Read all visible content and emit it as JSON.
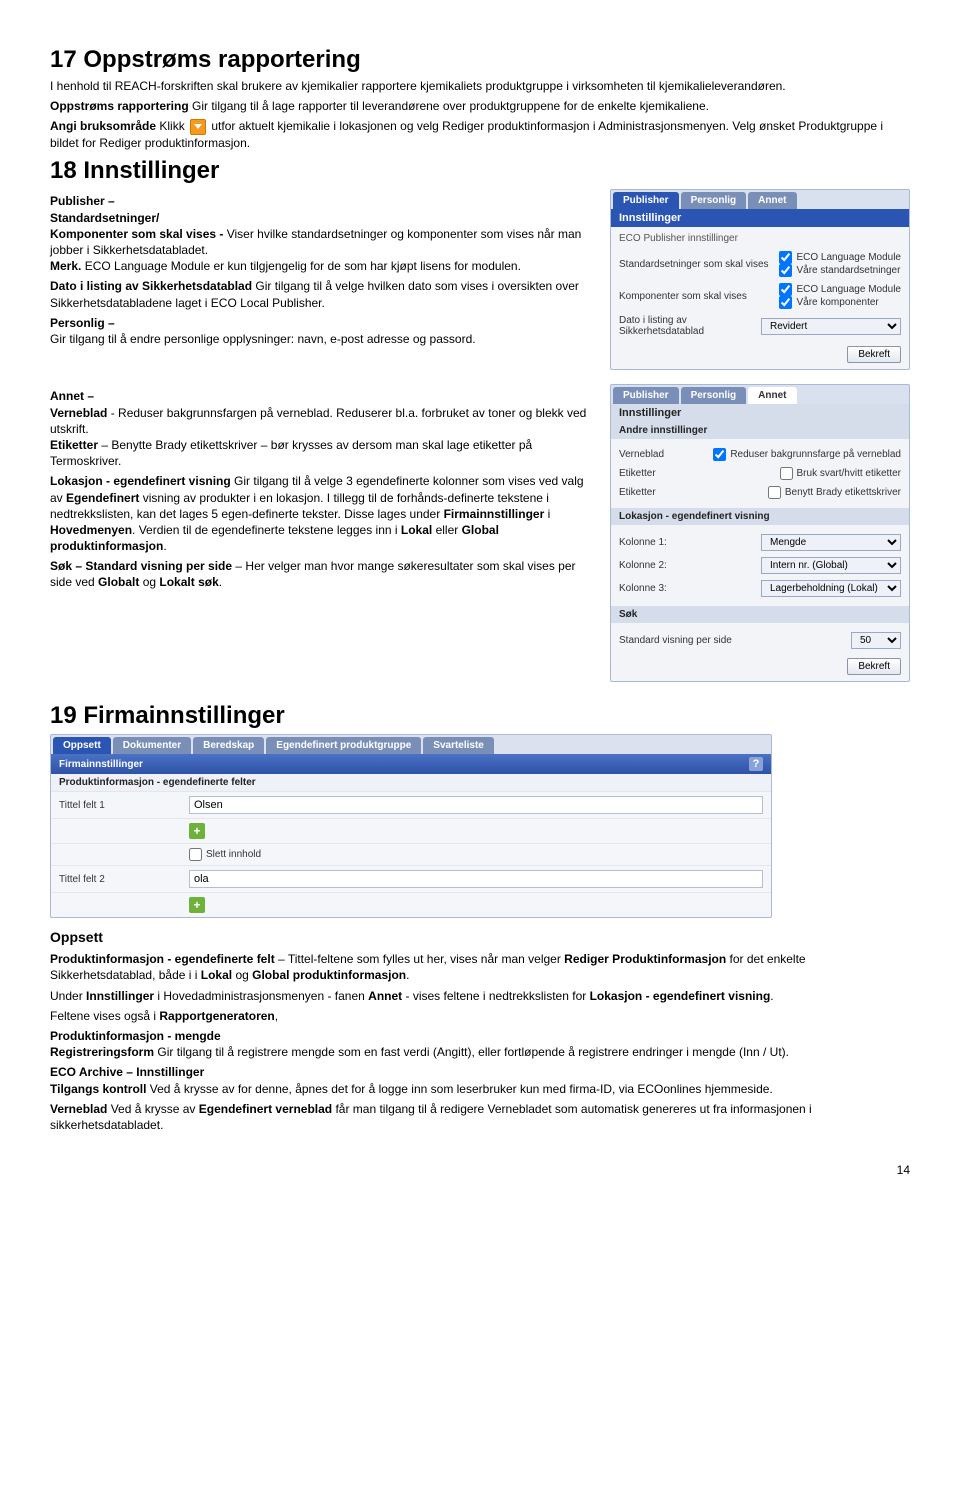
{
  "h17": "17 Oppstrøms rapportering",
  "p17a": "I henhold til REACH-forskriften skal brukere av kjemikalier rapportere kjemikaliets produktgruppe i virksomheten til kjemikalieleverandøren.",
  "p17b_pre": "Oppstrøms rapportering",
  "p17b": " Gir tilgang til å lage rapporter til leverandørene over produktgruppene for de enkelte kjemikaliene.",
  "p17c_pre": "Angi bruksområde",
  "p17c_mid": " Klikk ",
  "p17c_post": " utfor aktuelt kjemikalie i lokasjonen og velg Rediger produktinformasjon i Administrasjonsmenyen. Velg ønsket Produktgruppe i bildet for Rediger produktinformasjon.",
  "h18": "18 Innstillinger",
  "s18a_pre": "Publisher –",
  "s18a2": "Standardsetninger/",
  "s18a3_pre": "Komponenter som skal vises -",
  "s18a3": " Viser hvilke standardsetninger og komponenter som vises når man jobber i Sikkerhetsdatabladet.",
  "s18a4_pre": "Merk.",
  "s18a4": " ECO Language Module er kun tilgjengelig for de som har kjøpt lisens for modulen.",
  "s18b_pre": "Dato i listing av Sikkerhetsdatablad",
  "s18b": " Gir tilgang til å velge hvilken dato som vises i oversikten over Sikkerhetsdatabladene laget i ECO Local Publisher.",
  "s18c_pre": "Personlig –",
  "s18c": "Gir tilgang til å endre personlige opplysninger: navn, e-post adresse og passord.",
  "s18d_pre": "Annet –",
  "s18d_v_pre": "Verneblad",
  "s18d_v": " - Reduser bakgrunnsfargen på verneblad. Reduserer bl.a. forbruket av toner og blekk ved utskrift.",
  "s18d_e_pre": "Etiketter",
  "s18d_e": " – Benytte Brady etikettskriver – bør krysses av dersom man skal lage etiketter på Termoskriver.",
  "s18e_pre": "Lokasjon - egendefinert visning",
  "s18e": " Gir tilgang til å velge 3 egendefinerte kolonner som vises ved valg av ",
  "s18e_b2": "Egendefinert",
  "s18e2": " visning av produkter i en lokasjon. I tillegg til de forhånds-definerte tekstene i nedtrekkslisten, kan det lages 5 egen-definerte tekster. Disse lages under ",
  "s18e_b3": "Firmainnstillinger",
  "s18e3": " i ",
  "s18e_b4": "Hovedmenyen",
  "s18e4": ". Verdien til de egendefinerte tekstene legges inn i ",
  "s18e_b5": "Lokal",
  "s18e5": " eller ",
  "s18e_b6": "Global produktinformasjon",
  "s18e6": ".",
  "s18f_pre": "Søk – Standard visning per side",
  "s18f": " – Her velger man hvor mange søkeresultater som skal vises per side ved ",
  "s18f_b2": "Globalt",
  "s18f2": " og ",
  "s18f_b3": "Lokalt søk",
  "s18f3": ".",
  "panel1": {
    "tab_publisher": "Publisher",
    "tab_personlig": "Personlig",
    "tab_annet": "Annet",
    "title": "Innstillinger",
    "sub": "ECO Publisher innstillinger",
    "row1_lbl": "Standardsetninger som skal vises",
    "row1_cb1": "ECO Language Module",
    "row1_cb2": "Våre standardsetninger",
    "row2_lbl": "Komponenter som skal vises",
    "row2_cb1": "ECO Language Module",
    "row2_cb2": "Våre komponenter",
    "row3_lbl": "Dato i listing av Sikkerhetsdatablad",
    "row3_sel": "Revidert",
    "btn": "Bekreft"
  },
  "panel2": {
    "tab_publisher": "Publisher",
    "tab_personlig": "Personlig",
    "tab_annet": "Annet",
    "title": "Innstillinger",
    "sub": "Andre innstillinger",
    "r1_lbl": "Verneblad",
    "r1_cb": "Reduser bakgrunnsfarge på verneblad",
    "r2_lbl": "Etiketter",
    "r2_cb": "Bruk svart/hvitt etiketter",
    "r3_lbl": "Etiketter",
    "r3_cb": "Benytt Brady etikettskriver",
    "sub2": "Lokasjon - egendefinert visning",
    "k1_lbl": "Kolonne 1:",
    "k1_sel": "Mengde",
    "k2_lbl": "Kolonne 2:",
    "k2_sel": "Intern nr. (Global)",
    "k3_lbl": "Kolonne 3:",
    "k3_sel": "Lagerbeholdning (Lokal)",
    "sub3": "Søk",
    "s1_lbl": "Standard visning per side",
    "s1_sel": "50",
    "btn": "Bekreft"
  },
  "h19": "19 Firmainnstillinger",
  "panel3": {
    "tab1": "Oppsett",
    "tab2": "Dokumenter",
    "tab3": "Beredskap",
    "tab4": "Egendefinert produktgruppe",
    "tab5": "Svarteliste",
    "title": "Firmainnstillinger",
    "sub": "Produktinformasjon - egendefinerte felter",
    "f1_lbl": "Tittel felt 1",
    "f1_val": "Olsen",
    "slett": "Slett innhold",
    "f2_lbl": "Tittel felt 2",
    "f2_val": "ola"
  },
  "oppsett_h": "Oppsett",
  "op1_pre": "Produktinformasjon - egendefinerte felt",
  "op1": " – Tittel-feltene som fylles ut her, vises når man velger ",
  "op1_b2": "Rediger Produktinformasjon",
  "op1b": " for det enkelte Sikkerhetsdatablad, både i i ",
  "op1_b3": "Lokal",
  "op1c": " og ",
  "op1_b4": "Global produktinformasjon",
  "op1d": ".",
  "op2a": "Under ",
  "op2_b1": "Innstillinger",
  "op2b": " i Hovedadministrasjonsmenyen - fanen ",
  "op2_b2": "Annet",
  "op2c": " - vises feltene i nedtrekkslisten for ",
  "op2_b3": "Lokasjon - egendefinert visning",
  "op2d": ".",
  "op3a": "Feltene vises også i ",
  "op3_b1": "Rapportgeneratoren",
  "op3b": ",",
  "pm_h": "Produktinformasjon - mengde",
  "pm_pre": "Registreringsform",
  "pm": " Gir tilgang til å registrere mengde som en fast verdi (Angitt), eller fortløpende å registrere endringer i mengde (Inn / Ut).",
  "eco_h": "ECO Archive – Innstillinger",
  "eco_pre": "Tilgangs kontroll",
  "eco": " Ved å krysse av for denne, åpnes det for å logge inn som leserbruker kun med firma-ID, via ECOonlines hjemmeside.",
  "vern_pre": "Verneblad",
  "vern": " Ved å krysse av ",
  "vern_b2": "Egendefinert verneblad",
  "vern2": " får man tilgang til å redigere Vernebladet som automatisk genereres ut fra informasjonen i sikkerhetsdatabladet.",
  "pagenum": "14"
}
